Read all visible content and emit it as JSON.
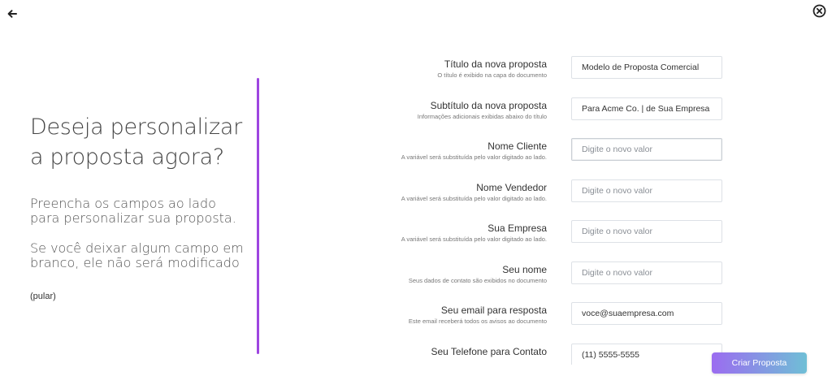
{
  "intro": {
    "heading": "Deseja personalizar a proposta agora?",
    "fill_text": "Preencha os campos ao lado para personalizar sua proposta.",
    "blank_text": "Se você deixar algum campo em branco, ele não será modificado",
    "skip_label": "(pular)"
  },
  "fields": [
    {
      "label": "Título da nova proposta",
      "hint": "O título é exibido na capa do documento",
      "value": "Modelo de Proposta Comercial",
      "placeholder": "Digite o novo valor"
    },
    {
      "label": "Subtítulo da nova proposta",
      "hint": "Informações adicionais exibidas abaixo do título",
      "value": "Para Acme Co. | de Sua Empresa",
      "placeholder": "Digite o novo valor"
    },
    {
      "label": "Nome Cliente",
      "hint": "A variável será substituída pelo valor digitado ao lado.",
      "value": "",
      "placeholder": "Digite o novo valor"
    },
    {
      "label": "Nome Vendedor",
      "hint": "A variável será substituída pelo valor digitado ao lado.",
      "value": "",
      "placeholder": "Digite o novo valor"
    },
    {
      "label": "Sua Empresa",
      "hint": "A variável será substituída pelo valor digitado ao lado.",
      "value": "",
      "placeholder": "Digite o novo valor"
    },
    {
      "label": "Seu nome",
      "hint": "Seus dados de contato são exibidos no documento",
      "value": "",
      "placeholder": "Digite o novo valor"
    },
    {
      "label": "Seu email para resposta",
      "hint": "Este email receberá todos os avisos ao documento",
      "value": "voce@suaempresa.com",
      "placeholder": "Digite o novo valor"
    },
    {
      "label": "Seu Telefone para Contato",
      "hint": "",
      "value": "(11) 5555-5555",
      "placeholder": "Digite o novo valor"
    }
  ],
  "actions": {
    "submit_label": "Criar Proposta"
  },
  "colors": {
    "divider": "#9d45e0",
    "button_gradient_start": "#9b6cf0",
    "button_gradient_end": "#6fbfd6"
  },
  "icons": {
    "back": "arrow-left-icon",
    "close": "close-circle-icon"
  }
}
